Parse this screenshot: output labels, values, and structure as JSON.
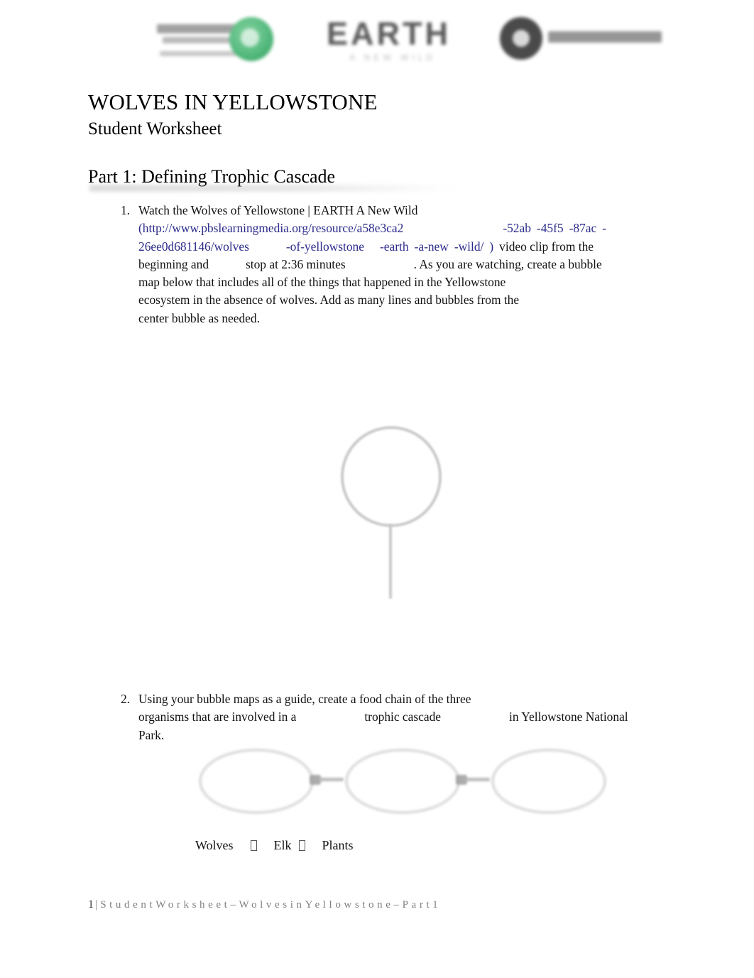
{
  "document": {
    "title": "WOLVES IN YELLOWSTONE",
    "subtitle": "Student Worksheet",
    "part_heading": "Part 1: Defining Trophic Cascade"
  },
  "header_logos": [
    {
      "name": "pbs-learningmedia-logo",
      "alt": "PBS LearningMedia"
    },
    {
      "name": "earth-a-new-wild-logo",
      "wordmark": "EARTH",
      "tagline": "A NEW WILD"
    },
    {
      "name": "national-geographic-logo",
      "alt": "National Geographic"
    }
  ],
  "items": [
    {
      "number": "1.",
      "line1_a": "Watch the Wolves of Yellowstone | EARTH A New Wild",
      "url_open_paren": "(",
      "url_part1": "http://www.pbslearningmedia.org/resource/a58e3ca2",
      "url_part2": "-52ab",
      "url_part3": "-45f5",
      "url_part4": "-87ac",
      "url_part5": "-",
      "url_part6": "26ee0d681146/wolves",
      "url_part7": "-of",
      "url_part8": "-yellowstone",
      "url_part9": "-earth",
      "url_part10": "-a",
      "url_part11": "-new",
      "url_part12": "-wild/",
      "url_close_paren": ")",
      "after_url": "video clip from the",
      "line4_a": "beginning and",
      "line4_b": "stop at 2:36 minutes",
      "line4_c": ". As you are watching, create a bubble",
      "line5": "map below that includes all of the things that happened in the Yellowstone",
      "line6": "ecosystem in the absence of wolves. Add as many lines and bubbles from the",
      "line7": "center bubble as needed."
    },
    {
      "number": "2.",
      "line1": "Using your bubble maps as a guide, create a food chain of the three",
      "line2_a": "organisms that are involved in a",
      "line2_b": "trophic cascade",
      "line2_c": "in Yellowstone National",
      "line3": "Park."
    }
  ],
  "bubble_map": {
    "name": "center-bubble-placeholder",
    "shape": "circle-with-stem"
  },
  "food_chain": {
    "bubbles": [
      "",
      "",
      ""
    ],
    "labels": {
      "first": "Wolves",
      "second": "Elk",
      "third": "Plants",
      "arrow_glyph": ""
    }
  },
  "footer": {
    "page_number": "1",
    "separator": "|",
    "text": "StudentWorksheet–WolvesinYellowstone–Part1"
  },
  "colors": {
    "link": "#2b2b8c",
    "text": "#111111",
    "footer_text": "#808080",
    "shape_outline": "#c9c9c9",
    "logo_green": "#4fb97a"
  }
}
